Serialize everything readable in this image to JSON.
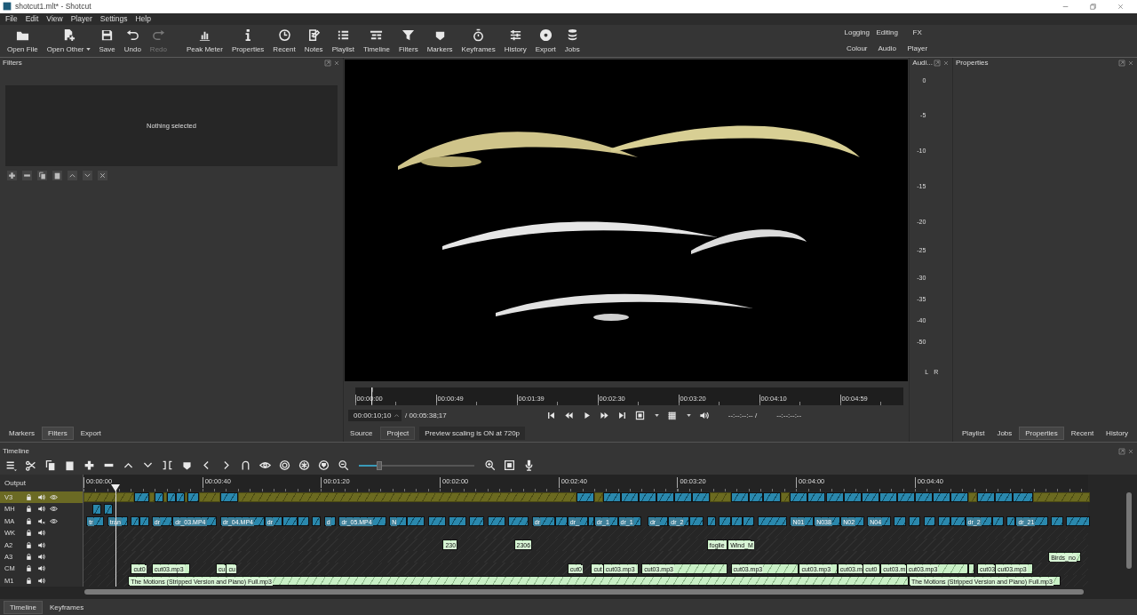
{
  "window": {
    "title": "shotcut1.mlt* - Shotcut"
  },
  "menu": [
    "File",
    "Edit",
    "View",
    "Player",
    "Settings",
    "Help"
  ],
  "toolbar": [
    {
      "label": "Open File",
      "disabled": false,
      "has_menu": false
    },
    {
      "label": "Open Other",
      "disabled": false,
      "has_menu": true
    },
    {
      "label": "Save",
      "disabled": false,
      "has_menu": false
    },
    {
      "label": "Undo",
      "disabled": false,
      "has_menu": false
    },
    {
      "label": "Redo",
      "disabled": true,
      "has_menu": false
    },
    {
      "label": "Peak Meter",
      "disabled": false,
      "has_menu": false
    },
    {
      "label": "Properties",
      "disabled": false,
      "has_menu": false
    },
    {
      "label": "Recent",
      "disabled": false,
      "has_menu": false
    },
    {
      "label": "Notes",
      "disabled": false,
      "has_menu": false
    },
    {
      "label": "Playlist",
      "disabled": false,
      "has_menu": false
    },
    {
      "label": "Timeline",
      "disabled": false,
      "has_menu": false
    },
    {
      "label": "Filters",
      "disabled": false,
      "has_menu": false
    },
    {
      "label": "Markers",
      "disabled": false,
      "has_menu": false
    },
    {
      "label": "Keyframes",
      "disabled": false,
      "has_menu": false
    },
    {
      "label": "History",
      "disabled": false,
      "has_menu": false
    },
    {
      "label": "Export",
      "disabled": false,
      "has_menu": false
    },
    {
      "label": "Jobs",
      "disabled": false,
      "has_menu": false
    }
  ],
  "layouts": [
    "Logging",
    "Editing",
    "FX",
    "Colour",
    "Audio",
    "Player"
  ],
  "filters_panel": {
    "title": "Filters",
    "message": "Nothing selected",
    "tabs": [
      {
        "label": "Markers",
        "selected": false
      },
      {
        "label": "Filters",
        "selected": true
      },
      {
        "label": "Export",
        "selected": false
      }
    ]
  },
  "viewer": {
    "ruler": [
      "00:00:00",
      "00:00:49",
      "00:01:39",
      "00:02:30",
      "00:03:20",
      "00:04:10",
      "00:04:59"
    ],
    "position": "00:00:10;10",
    "duration": "/ 00:05:38;17",
    "in_point": "--:--:--:-- /",
    "out_point": "--:--:--:--",
    "tabs": [
      {
        "label": "Source",
        "selected": false
      },
      {
        "label": "Project",
        "selected": true
      }
    ],
    "status": "Preview scaling is ON at 720p"
  },
  "audio_meter": {
    "title": "Audi...",
    "scale": [
      "0",
      "-5",
      "-10",
      "-15",
      "-20",
      "-25",
      "-30",
      "-35",
      "-40",
      "-50"
    ],
    "channels": [
      "L",
      "R"
    ]
  },
  "properties_panel": {
    "title": "Properties",
    "tabs": [
      {
        "label": "Playlist",
        "selected": false
      },
      {
        "label": "Jobs",
        "selected": false
      },
      {
        "label": "Properties",
        "selected": true
      },
      {
        "label": "Recent",
        "selected": false
      },
      {
        "label": "History",
        "selected": false
      }
    ]
  },
  "timeline": {
    "title": "Timeline",
    "zoom": {
      "level": 0.18
    },
    "output_label": "Output",
    "ruler": [
      "00:00:00",
      "00:00:40",
      "00:01:20",
      "00:02:00",
      "00:02:40",
      "00:03:20",
      "00:04:00",
      "00:04:40"
    ],
    "tracks": [
      {
        "name": "V3",
        "kind": "video",
        "selected": true,
        "muted": false,
        "clips": [
          {
            "kind": "color"
          },
          {
            "kind": "video"
          },
          {
            "kind": "color"
          },
          {
            "kind": "video"
          },
          {
            "kind": "color"
          },
          {
            "kind": "video"
          },
          {
            "kind": "video"
          },
          {
            "kind": "color"
          },
          {
            "kind": "video"
          },
          {
            "kind": "color"
          },
          {
            "kind": "video"
          },
          {
            "kind": "color"
          },
          {
            "kind": "video"
          },
          {
            "kind": "color"
          },
          {
            "kind": "video"
          },
          {
            "kind": "video"
          },
          {
            "kind": "video"
          },
          {
            "kind": "video"
          },
          {
            "kind": "video"
          },
          {
            "kind": "video"
          },
          {
            "kind": "color"
          },
          {
            "kind": "video"
          },
          {
            "kind": "video"
          },
          {
            "kind": "video"
          },
          {
            "kind": "color"
          },
          {
            "kind": "video"
          },
          {
            "kind": "video"
          },
          {
            "kind": "video"
          },
          {
            "kind": "video"
          },
          {
            "kind": "video"
          },
          {
            "kind": "video"
          },
          {
            "kind": "video"
          },
          {
            "kind": "video"
          },
          {
            "kind": "video"
          },
          {
            "kind": "video"
          },
          {
            "kind": "color"
          },
          {
            "kind": "video"
          },
          {
            "kind": "video"
          },
          {
            "kind": "video"
          },
          {
            "kind": "color"
          }
        ]
      },
      {
        "name": "MH",
        "kind": "video",
        "selected": false,
        "muted": false,
        "clips": [
          {
            "kind": "video"
          },
          {
            "kind": "video"
          }
        ]
      },
      {
        "name": "MA",
        "kind": "video",
        "selected": false,
        "muted": true,
        "clips": [
          {
            "kind": "video",
            "label": "tr"
          },
          {
            "kind": "video",
            "label": "tran"
          },
          {
            "kind": "video"
          },
          {
            "kind": "video"
          },
          {
            "kind": "video",
            "label": "dr"
          },
          {
            "kind": "video",
            "label": "dr_03.MP4"
          },
          {
            "kind": "video",
            "label": "dr_04.MP4"
          },
          {
            "kind": "video",
            "label": "dr"
          },
          {
            "kind": "video"
          },
          {
            "kind": "video"
          },
          {
            "kind": "video"
          },
          {
            "kind": "video",
            "label": "d"
          },
          {
            "kind": "video",
            "label": "dr_05.MP4"
          },
          {
            "kind": "video",
            "label": "N"
          },
          {
            "kind": "video"
          },
          {
            "kind": "video"
          },
          {
            "kind": "video"
          },
          {
            "kind": "video"
          },
          {
            "kind": "video"
          },
          {
            "kind": "video"
          },
          {
            "kind": "video",
            "label": "dr"
          },
          {
            "kind": "video"
          },
          {
            "kind": "video",
            "label": "dr_"
          },
          {
            "kind": "video"
          },
          {
            "kind": "video",
            "label": "dr_1"
          },
          {
            "kind": "video",
            "label": "dr_1"
          },
          {
            "kind": "video",
            "label": "dr_"
          },
          {
            "kind": "video",
            "label": "dr_2"
          },
          {
            "kind": "video"
          },
          {
            "kind": "video"
          },
          {
            "kind": "video"
          },
          {
            "kind": "video"
          },
          {
            "kind": "video"
          },
          {
            "kind": "video"
          },
          {
            "kind": "video",
            "label": "N01"
          },
          {
            "kind": "video",
            "label": "N038"
          },
          {
            "kind": "video",
            "label": "N02"
          },
          {
            "kind": "video",
            "label": "N04"
          },
          {
            "kind": "video"
          },
          {
            "kind": "video"
          },
          {
            "kind": "video"
          },
          {
            "kind": "video"
          },
          {
            "kind": "video"
          },
          {
            "kind": "video",
            "label": "dr_2"
          },
          {
            "kind": "video"
          },
          {
            "kind": "video"
          },
          {
            "kind": "video",
            "label": "dr_21"
          },
          {
            "kind": "video"
          },
          {
            "kind": "video"
          }
        ]
      },
      {
        "name": "WK",
        "kind": "audio",
        "selected": false,
        "muted": false
      },
      {
        "name": "A2",
        "kind": "audio",
        "selected": false,
        "muted": false,
        "clips": [
          {
            "kind": "audio",
            "label": "230"
          },
          {
            "kind": "audio",
            "label": "2306"
          },
          {
            "kind": "audio",
            "label": "foglie"
          },
          {
            "kind": "audio",
            "label": "Wind_M"
          }
        ]
      },
      {
        "name": "A3",
        "kind": "audio",
        "selected": false,
        "muted": false,
        "clips": [
          {
            "kind": "audio",
            "label": "Birds_no"
          }
        ]
      },
      {
        "name": "CM",
        "kind": "audio",
        "selected": false,
        "muted": false,
        "clips": [
          {
            "kind": "audio",
            "label": "cut0"
          },
          {
            "kind": "audio",
            "label": "cut03.mp3"
          },
          {
            "kind": "audio",
            "label": "cu"
          },
          {
            "kind": "audio",
            "label": "cu"
          },
          {
            "kind": "audio",
            "label": "cut0"
          },
          {
            "kind": "audio",
            "label": "cut"
          },
          {
            "kind": "audio",
            "label": "cut03.mp3"
          },
          {
            "kind": "audio",
            "label": "cut03.mp3"
          },
          {
            "kind": "audio",
            "label": "cut03.mp3"
          },
          {
            "kind": "audio",
            "label": "cut03.mp3"
          },
          {
            "kind": "audio",
            "label": "cut03.m"
          },
          {
            "kind": "audio",
            "label": "cut0"
          },
          {
            "kind": "audio",
            "label": "cut03.m"
          },
          {
            "kind": "audio",
            "label": "cut03.mp3"
          },
          {
            "kind": "audio"
          },
          {
            "kind": "audio",
            "label": "cut03"
          },
          {
            "kind": "audio",
            "label": "cut03.mp3"
          }
        ]
      },
      {
        "name": "M1",
        "kind": "audio",
        "selected": false,
        "muted": false,
        "clips": [
          {
            "kind": "audio",
            "label": "The Motions (Stripped Version and Piano) Full.mp3"
          },
          {
            "kind": "audio",
            "label": "The Motions (Stripped Version and Piano) Full.mp3"
          }
        ]
      }
    ],
    "tabs": [
      {
        "label": "Timeline",
        "selected": true
      },
      {
        "label": "Keyframes",
        "selected": false
      }
    ]
  }
}
